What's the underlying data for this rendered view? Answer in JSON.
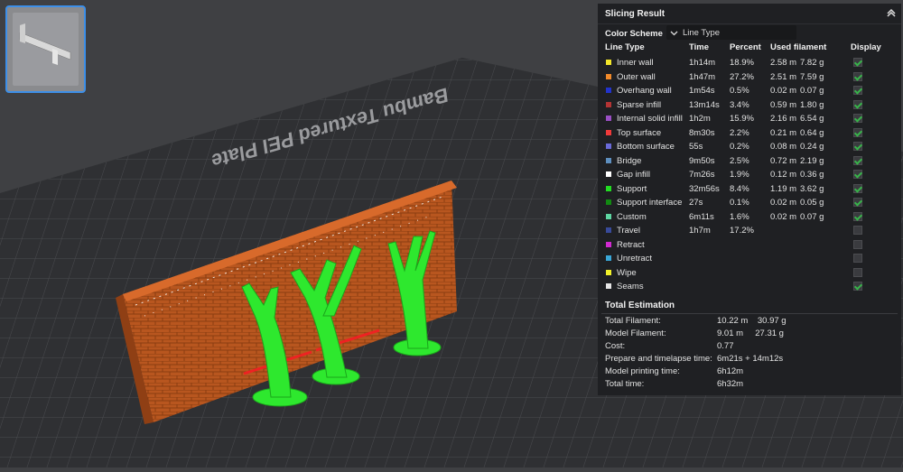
{
  "viewport": {
    "plate_label": "Bambu Textured PEI Plate"
  },
  "panel": {
    "title": "Slicing Result",
    "color_scheme_label": "Color Scheme",
    "color_scheme_value": "Line Type",
    "columns": {
      "line_type": "Line Type",
      "time": "Time",
      "percent": "Percent",
      "used_filament": "Used filament",
      "display": "Display"
    },
    "rows": [
      {
        "name": "Inner wall",
        "color": "#f2e62a",
        "time": "1h14m",
        "percent": "18.9%",
        "length": "2.58 m",
        "weight": "7.82 g",
        "display": true
      },
      {
        "name": "Outer wall",
        "color": "#f28a2a",
        "time": "1h47m",
        "percent": "27.2%",
        "length": "2.51 m",
        "weight": "7.59 g",
        "display": true
      },
      {
        "name": "Overhang wall",
        "color": "#2233cc",
        "time": "1m54s",
        "percent": "0.5%",
        "length": "0.02 m",
        "weight": "0.07 g",
        "display": true
      },
      {
        "name": "Sparse infill",
        "color": "#b43434",
        "time": "13m14s",
        "percent": "3.4%",
        "length": "0.59 m",
        "weight": "1.80 g",
        "display": true
      },
      {
        "name": "Internal solid infill",
        "color": "#9a4fc4",
        "time": "1h2m",
        "percent": "15.9%",
        "length": "2.16 m",
        "weight": "6.54 g",
        "display": true
      },
      {
        "name": "Top surface",
        "color": "#f03a3a",
        "time": "8m30s",
        "percent": "2.2%",
        "length": "0.21 m",
        "weight": "0.64 g",
        "display": true
      },
      {
        "name": "Bottom surface",
        "color": "#6a6ad8",
        "time": "55s",
        "percent": "0.2%",
        "length": "0.08 m",
        "weight": "0.24 g",
        "display": true
      },
      {
        "name": "Bridge",
        "color": "#5e8fbf",
        "time": "9m50s",
        "percent": "2.5%",
        "length": "0.72 m",
        "weight": "2.19 g",
        "display": true
      },
      {
        "name": "Gap infill",
        "color": "#ffffff",
        "time": "7m26s",
        "percent": "1.9%",
        "length": "0.12 m",
        "weight": "0.36 g",
        "display": true
      },
      {
        "name": "Support",
        "color": "#22dd22",
        "time": "32m56s",
        "percent": "8.4%",
        "length": "1.19 m",
        "weight": "3.62 g",
        "display": true
      },
      {
        "name": "Support interface",
        "color": "#128a12",
        "time": "27s",
        "percent": "0.1%",
        "length": "0.02 m",
        "weight": "0.05 g",
        "display": true
      },
      {
        "name": "Custom",
        "color": "#5ed6a2",
        "time": "6m11s",
        "percent": "1.6%",
        "length": "0.02 m",
        "weight": "0.07 g",
        "display": true
      },
      {
        "name": "Travel",
        "color": "#384a9a",
        "time": "1h7m",
        "percent": "17.2%",
        "length": "",
        "weight": "",
        "display": false
      },
      {
        "name": "Retract",
        "color": "#d22ad2",
        "time": "",
        "percent": "",
        "length": "",
        "weight": "",
        "display": false
      },
      {
        "name": "Unretract",
        "color": "#3aa8d8",
        "time": "",
        "percent": "",
        "length": "",
        "weight": "",
        "display": false
      },
      {
        "name": "Wipe",
        "color": "#f2f22a",
        "time": "",
        "percent": "",
        "length": "",
        "weight": "",
        "display": false
      },
      {
        "name": "Seams",
        "color": "#e6e6e6",
        "time": "",
        "percent": "",
        "length": "",
        "weight": "",
        "display": true
      }
    ],
    "total_title": "Total Estimation",
    "totals": [
      {
        "label": "Total Filament:",
        "value": "10.22 m    30.97 g"
      },
      {
        "label": "Model Filament:",
        "value": "9.01 m     27.31 g"
      },
      {
        "label": "Cost:",
        "value": "0.77"
      },
      {
        "label": "Prepare and timelapse time:",
        "value": "6m21s + 14m12s"
      },
      {
        "label": "Model printing time:",
        "value": "6h12m"
      },
      {
        "label": "Total time:",
        "value": "6h32m"
      }
    ]
  }
}
